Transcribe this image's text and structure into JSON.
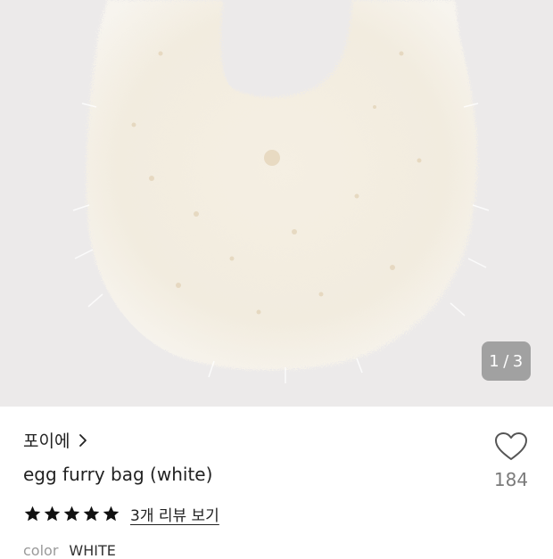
{
  "gallery": {
    "current": "1",
    "separator": "/",
    "total": "3",
    "image_alt": "egg furry bag white product photo"
  },
  "product": {
    "brand": "포이에",
    "title": "egg furry bag (white)",
    "rating": 5,
    "review_link": "3개 리뷰 보기",
    "like_count": "184",
    "option_label": "color",
    "option_value": "WHITE"
  },
  "icons": {
    "brand_chevron": "chevron-right-icon",
    "like": "heart-outline-icon",
    "star": "star-filled-icon"
  },
  "colors": {
    "accent_text": "#222222",
    "muted": "#7a7a7a",
    "photo_bg": "#eceaea"
  }
}
